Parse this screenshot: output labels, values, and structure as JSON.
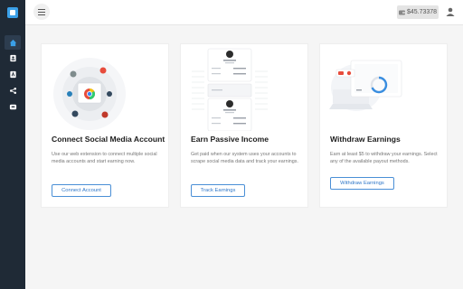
{
  "header": {
    "balance": "$45.73378"
  },
  "cards": [
    {
      "title": "Connect Social Media Account",
      "description": "Use our web extension to connect multiple social media accounts and start earning now.",
      "button_label": "Connect Account"
    },
    {
      "title": "Earn Passive Income",
      "description": "Get paid when our system uses your accounts to scrape social media data and track your earnings.",
      "button_label": "Track Earnings"
    },
    {
      "title": "Withdraw Earnings",
      "description": "Earn at least $5 to withdraw your earnings. Select any of the available payout methods.",
      "button_label": "Withdraw Earnings"
    }
  ],
  "colors": {
    "sidebar": "#1f2a36",
    "accent": "#3aa0e8",
    "button_border": "#4a8fd6"
  }
}
